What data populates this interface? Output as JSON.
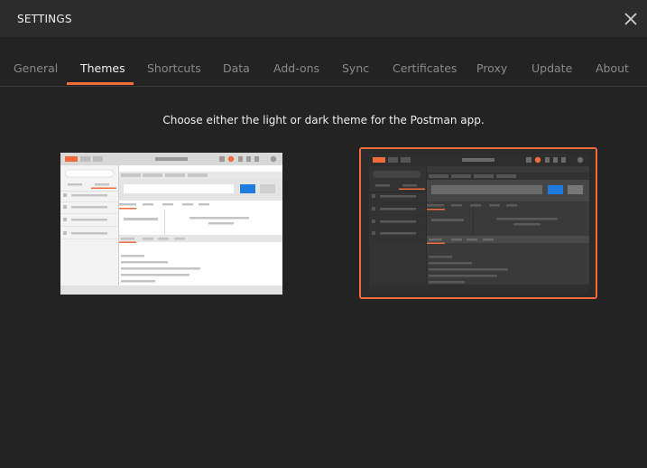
{
  "window": {
    "title": "SETTINGS"
  },
  "tabs": [
    {
      "label": "General",
      "active": false
    },
    {
      "label": "Themes",
      "active": true
    },
    {
      "label": "Shortcuts",
      "active": false
    },
    {
      "label": "Data",
      "active": false
    },
    {
      "label": "Add-ons",
      "active": false
    },
    {
      "label": "Sync",
      "active": false
    },
    {
      "label": "Certificates",
      "active": false
    },
    {
      "label": "Proxy",
      "active": false
    },
    {
      "label": "Update",
      "active": false
    },
    {
      "label": "About",
      "active": false
    }
  ],
  "themes": {
    "description": "Choose either the light or dark theme for the Postman app.",
    "options": [
      {
        "id": "light",
        "selected": false
      },
      {
        "id": "dark",
        "selected": true
      }
    ]
  },
  "colors": {
    "accent": "#f26b3a",
    "background": "#232323",
    "header": "#2c2c2c",
    "inactive_tab": "#8a8a8a",
    "active_tab": "#f2f2f2",
    "send_button": "#1e7be0"
  },
  "icons": {
    "close": "close-icon"
  }
}
